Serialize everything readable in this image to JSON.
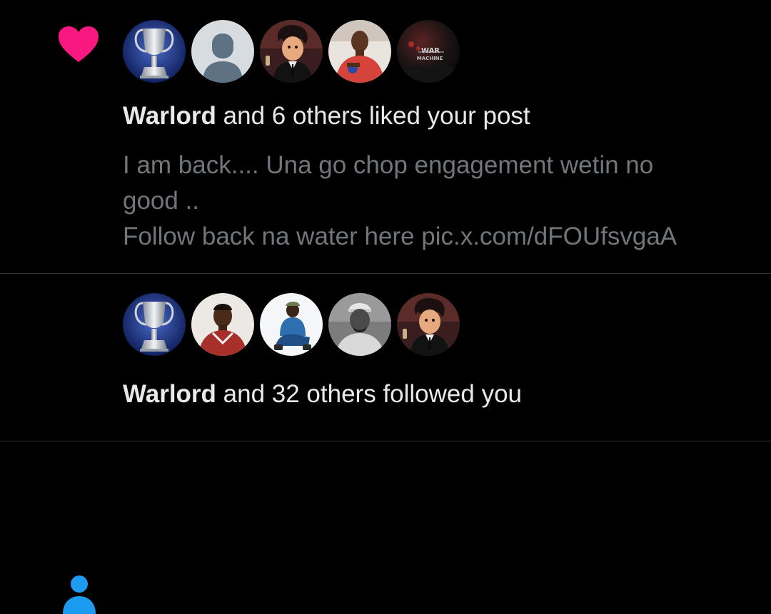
{
  "colors": {
    "background": "#000000",
    "primary_text": "#e7e9ea",
    "secondary_text": "#71767b",
    "like_accent": "#f91880",
    "follow_accent": "#1d9bf0",
    "divider": "#2f3336"
  },
  "notifications": [
    {
      "type": "like",
      "icon": "heart-icon",
      "avatars": [
        {
          "desc": "trophy-avatar"
        },
        {
          "desc": "default-avatar"
        },
        {
          "desc": "cartoon-suit-avatar"
        },
        {
          "desc": "red-shirt-avatar"
        },
        {
          "desc": "war-machine-avatar"
        }
      ],
      "actor": "Warlord",
      "action": " and 6 others liked your post",
      "post_lines": [
        "I am back.... Una go chop engagement wetin no",
        "good ..",
        "Follow back na water here pic.x.com/dFOUfsvgaA"
      ],
      "war_machine_text": "WAR MACHINE"
    },
    {
      "type": "follow",
      "icon": "person-icon",
      "avatars": [
        {
          "desc": "trophy-avatar"
        },
        {
          "desc": "red-shirt-man-avatar"
        },
        {
          "desc": "sitting-man-avatar"
        },
        {
          "desc": "grayscale-cap-avatar"
        },
        {
          "desc": "cartoon-suit-avatar"
        }
      ],
      "actor": "Warlord",
      "action": " and 32 others followed you"
    }
  ]
}
